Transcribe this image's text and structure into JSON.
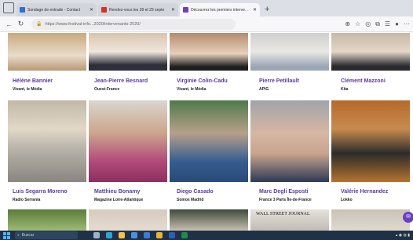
{
  "browser": {
    "tabs": [
      {
        "title": "Sondage de entrade - Contact",
        "active": false,
        "favicon_color": "#2e6fd6"
      },
      {
        "title": "Rendez-vous les 28 et 29 septe",
        "active": false,
        "favicon_color": "#d93025"
      },
      {
        "title": "Découvrez les premiers intervenants",
        "active": true,
        "favicon_color": "#6b3fc4"
      }
    ],
    "new_tab_label": "+",
    "address_url": "https://www.festival-info...2020/intervenants-2020/"
  },
  "speakers": [
    {
      "name": "Hélène Bannier",
      "org": "Vivant, le Média"
    },
    {
      "name": "Jean-Pierre Besnard",
      "org": "Ouest-France"
    },
    {
      "name": "Virginie Colin-Cadu",
      "org": "Vivant, le Média"
    },
    {
      "name": "Pierre Petillault",
      "org": "APIG"
    },
    {
      "name": "Clément Mazzoni",
      "org": "Kita"
    },
    {
      "name": "Luis Segarra Moreno",
      "org": "Radio Serrania"
    },
    {
      "name": "Matthieu Bonamy",
      "org": "Magazine Loire-Atlantique"
    },
    {
      "name": "Diego Casado",
      "org": "Somos Madrid"
    },
    {
      "name": "Marc Degli Esposti",
      "org": "France 3 Paris Île-de-France"
    },
    {
      "name": "Valérie Hernandez",
      "org": "Lokko"
    }
  ],
  "partial_row_text": "WALL STREET JOURNAL",
  "taskbar": {
    "search_placeholder": "Buscar"
  },
  "colors": {
    "accent": "#5a3aa5",
    "tab_bar": "#dcdfe6",
    "taskbar": "#1f3147"
  }
}
